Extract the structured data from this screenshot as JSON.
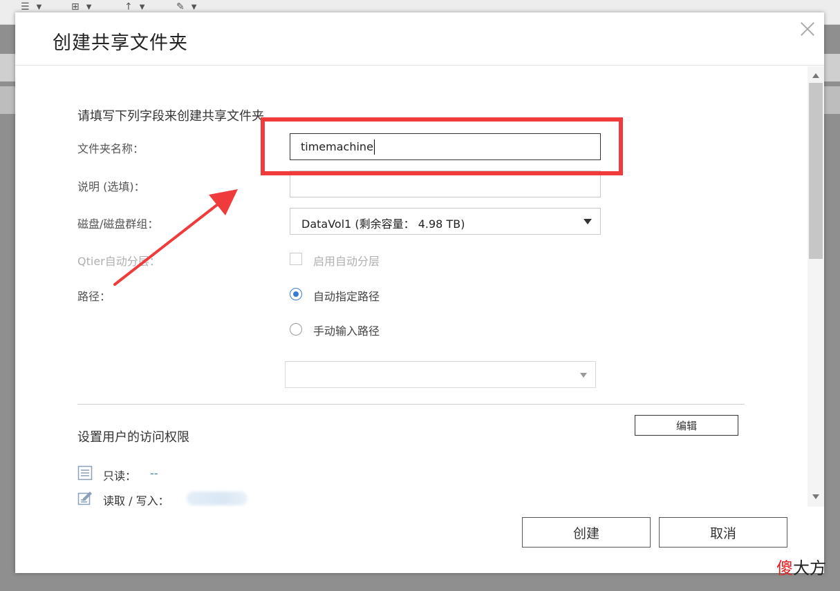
{
  "dialog": {
    "title": "创建共享文件夹",
    "close_icon": "close-icon"
  },
  "form": {
    "section_title": "请填写下列字段来创建共享文件夹",
    "folder_name_label": "文件夹名称：",
    "folder_name_value": "timemachine",
    "description_label": "说明 (选填)：",
    "description_value": "",
    "disk_label": "磁盘/磁盘群组：",
    "disk_value": "DataVol1 (剩余容量： 4.98 TB)",
    "qtier_label": "Qtier自动分层：",
    "qtier_option": "启用自动分层",
    "qtier_checked": false,
    "path_label": "路径：",
    "path_options": [
      {
        "label": "自动指定路径",
        "checked": true
      },
      {
        "label": "手动输入路径",
        "checked": false
      }
    ],
    "path_select_value": ""
  },
  "permissions": {
    "section_title": "设置用户的访问权限",
    "edit_label": "编辑",
    "read_only_label": "只读：",
    "read_only_value": "--",
    "read_write_label": "读取 / 写入：",
    "read_only_icon": "document-list-icon",
    "read_write_icon": "edit-document-icon"
  },
  "footer": {
    "create_label": "创建",
    "cancel_label": "取消"
  },
  "annotation": {
    "highlight_color": "#ef3b3b"
  },
  "watermark": {
    "char_red": "傻",
    "text": "大方"
  },
  "colors": {
    "accent": "#3b7bd4"
  }
}
